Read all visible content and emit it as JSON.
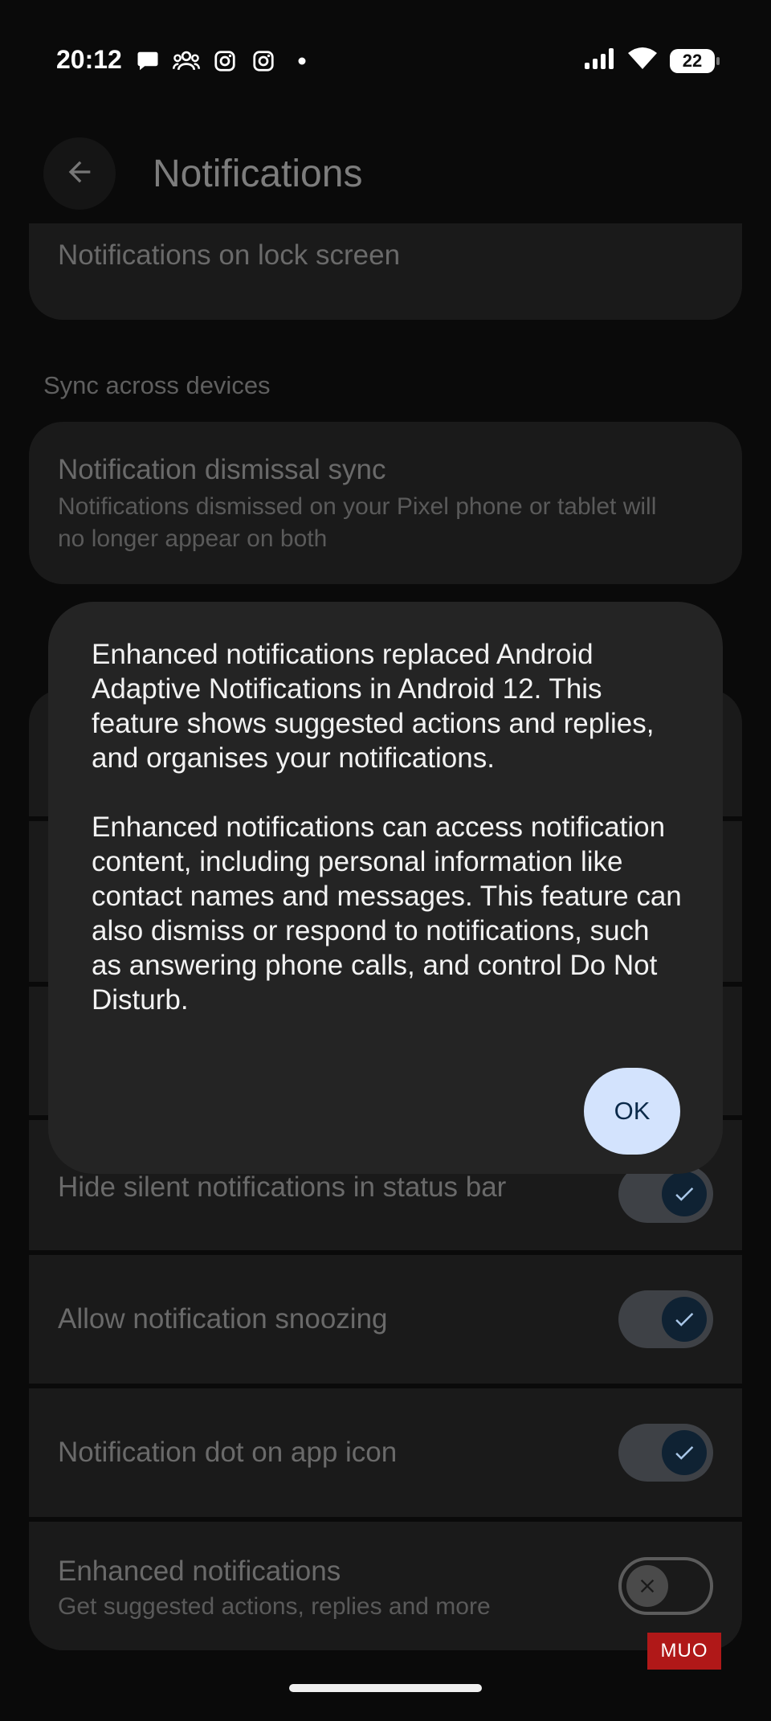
{
  "status_bar": {
    "time": "20:12",
    "notification_icons": [
      "message-icon",
      "group-icon",
      "instagram-icon",
      "instagram-icon",
      "dot-icon"
    ],
    "battery": "22"
  },
  "app_bar": {
    "title": "Notifications",
    "back_icon": "arrow-back-icon"
  },
  "settings": {
    "lock_screen_title": "Notifications on lock screen",
    "sync_section": "Sync across devices",
    "dismissal_sync_title": "Notification dismissal sync",
    "dismissal_sync_subtitle": "Notifications dismissed on your Pixel phone or tablet will no longer appear on both",
    "hide_silent_title": "Hide silent notifications in status bar",
    "hide_silent_enabled": true,
    "snoozing_title": "Allow notification snoozing",
    "snoozing_enabled": true,
    "dot_title": "Notification dot on app icon",
    "dot_enabled": true,
    "enhanced_title": "Enhanced notifications",
    "enhanced_subtitle": "Get suggested actions, replies and more",
    "enhanced_enabled": false
  },
  "dialog": {
    "paragraph_1": "Enhanced notifications replaced Android Adaptive Notifications in Android 12. This feature shows suggested actions and replies, and organises your notifications.",
    "paragraph_2": "Enhanced notifications can access notification content, including personal information like contact names and messages. This feature can also dismiss or respond to notifications, such as answering phone calls, and control Do Not Disturb.",
    "ok_label": "OK"
  },
  "watermark": "MUO",
  "colors": {
    "accent": "#d3e3fd",
    "dialog_bg": "#242424",
    "toggle_track_on": "#3e4146",
    "toggle_knob_on": "#0f2233"
  }
}
